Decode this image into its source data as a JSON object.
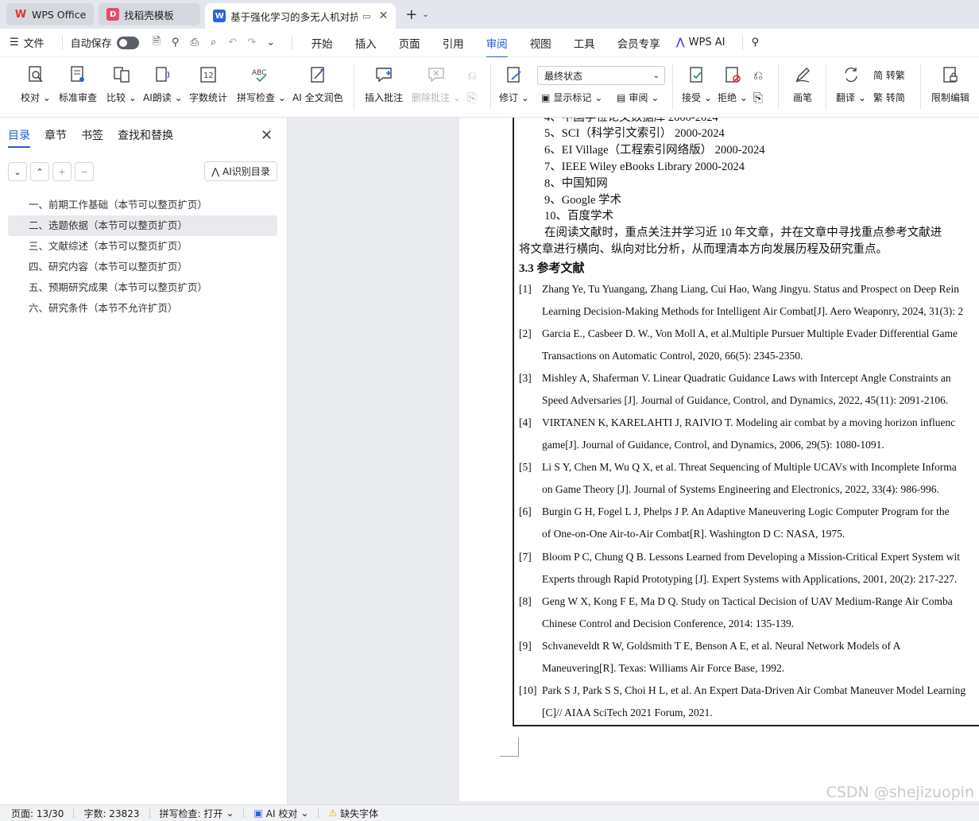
{
  "tabs": [
    {
      "label": "WPS Office",
      "icon": "wps-logo-icon",
      "color": "#e8332a"
    },
    {
      "label": "找稻壳模板",
      "icon": "docer-icon",
      "color": "#e84a6b"
    },
    {
      "label": "基于强化学习的多无人机对抗",
      "icon": "word-doc-icon",
      "color": "#2b63d8"
    }
  ],
  "menubar": {
    "file": "文件",
    "autosave": "自动保存",
    "tabs": [
      "开始",
      "插入",
      "页面",
      "引用",
      "审阅",
      "视图",
      "工具",
      "会员专享"
    ],
    "active_tab": "审阅",
    "wps_ai": "WPS AI"
  },
  "ribbon": {
    "proofread": "校对",
    "standard_review": "标准审查",
    "compare": "比较",
    "ai_read": "AI朗读",
    "word_count": "字数统计",
    "spell_check": "拼写检查",
    "ai_polish": "AI 全文润色",
    "insert_comment": "插入批注",
    "delete_comment": "删除批注",
    "revise": "修订",
    "state_select": "最终状态",
    "show_marks": "显示标记",
    "review": "审阅",
    "accept": "接受",
    "reject": "拒绝",
    "brush": "画笔",
    "translate": "翻译",
    "to_traditional": "简 转繁",
    "to_simplified": "繁 转简",
    "restrict_edit": "限制编辑"
  },
  "nav": {
    "tabs": [
      "目录",
      "章节",
      "书签",
      "查找和替换"
    ],
    "active_tab": "目录",
    "ai_button": "AI识别目录",
    "toc": [
      "一、前期工作基础（本节可以整页扩页）",
      "二、选题依据（本节可以整页扩页）",
      "三、文献综述（本节可以整页扩页）",
      "四、研究内容（本节可以整页扩页）",
      "五、预期研究成果（本节可以整页扩页）",
      "六、研究条件（本节不允许扩页）"
    ],
    "selected_index": 1
  },
  "document": {
    "partial_top": "4、中国学位论文数据库  2000-2024",
    "db_list": [
      "5、SCI（科学引文索引）   2000-2024",
      "6、EI Village（工程索引网络版）   2000-2024",
      "7、IEEE Wiley eBooks Library 2000-2024",
      "8、中国知网",
      "9、Google  学术",
      "10、百度学术"
    ],
    "para_line1": "在阅读文献时，重点关注并学习近  10  年文章，并在文章中寻找重点参考文献进",
    "para_line2": "将文章进行横向、纵向对比分析，从而理清本方向发展历程及研究重点。",
    "heading": "3.3 参考文献",
    "references": [
      {
        "num": "[1]",
        "l1": "Zhang Ye, Tu Yuangang, Zhang Liang, Cui Hao, Wang Jingyu. Status and Prospect on Deep Rein",
        "l2": "Learning Decision-Making Methods for Intelligent Air Combat[J]. Aero Weaponry, 2024, 31(3): 2"
      },
      {
        "num": "[2]",
        "l1": "Garcia E., Casbeer D. W., Von Moll A, et al.Multiple Pursuer Multiple Evader Differential Game",
        "l2": "Transactions on Automatic Control, 2020, 66(5): 2345-2350."
      },
      {
        "num": "[3]",
        "l1": "Mishley A, Shaferman V. Linear Quadratic Guidance Laws with Intercept Angle Constraints an",
        "l2": "Speed Adversaries [J]. Journal of Guidance, Control, and Dynamics, 2022, 45(11): 2091-2106."
      },
      {
        "num": "[4]",
        "l1": "VIRTANEN K, KARELAHTI J, RAIVIO T. Modeling air combat by a moving horizon influenc",
        "l2": "game[J]. Journal of Guidance, Control, and Dynamics, 2006, 29(5): 1080-1091."
      },
      {
        "num": "[5]",
        "l1": "Li S Y, Chen M, Wu Q X, et al. Threat Sequencing of Multiple UCAVs with Incomplete Informa",
        "l2": "on Game Theory [J]. Journal of Systems Engineering and Electronics, 2022, 33(4): 986-996."
      },
      {
        "num": "[6]",
        "l1": "Burgin G H, Fogel L J, Phelps J P. An Adaptive Maneuvering Logic Computer Program for the",
        "l2": "of One-on-One Air-to-Air Combat[R]. Washington D C: NASA, 1975."
      },
      {
        "num": "[7]",
        "l1": "Bloom P C, Chung Q B. Lessons Learned from Developing a Mission-Critical Expert System wit",
        "l2": "Experts through Rapid Prototyping [J]. Expert Systems with Applications, 2001, 20(2): 217-227."
      },
      {
        "num": "[8]",
        "l1": "Geng W X, Kong F E, Ma D Q. Study on Tactical Decision of UAV Medium-Range Air Comba",
        "l2": "Chinese Control and Decision Conference, 2014: 135-139."
      },
      {
        "num": "[9]",
        "l1": "Schvaneveldt  R  W,  Goldsmith  T  E,  Benson  A  E,  et  al.  Neural  Network  Models  of  A",
        "l2": "Maneuvering[R]. Texas: Williams Air Force Base, 1992."
      },
      {
        "num": "[10]",
        "l1": "Park S J, Park S S, Choi H L, et al. An Expert Data-Driven Air Combat Maneuver Model Learning",
        "l2": "[C]// AIAA SciTech 2021 Forum, 2021."
      }
    ]
  },
  "status": {
    "page": "页面: 13/30",
    "words": "字数: 23823",
    "spell": "拼写检查: 打开",
    "ai_proof": "AI 校对",
    "missing_font": "缺失字体"
  },
  "watermark": "CSDN @shejizuopin"
}
